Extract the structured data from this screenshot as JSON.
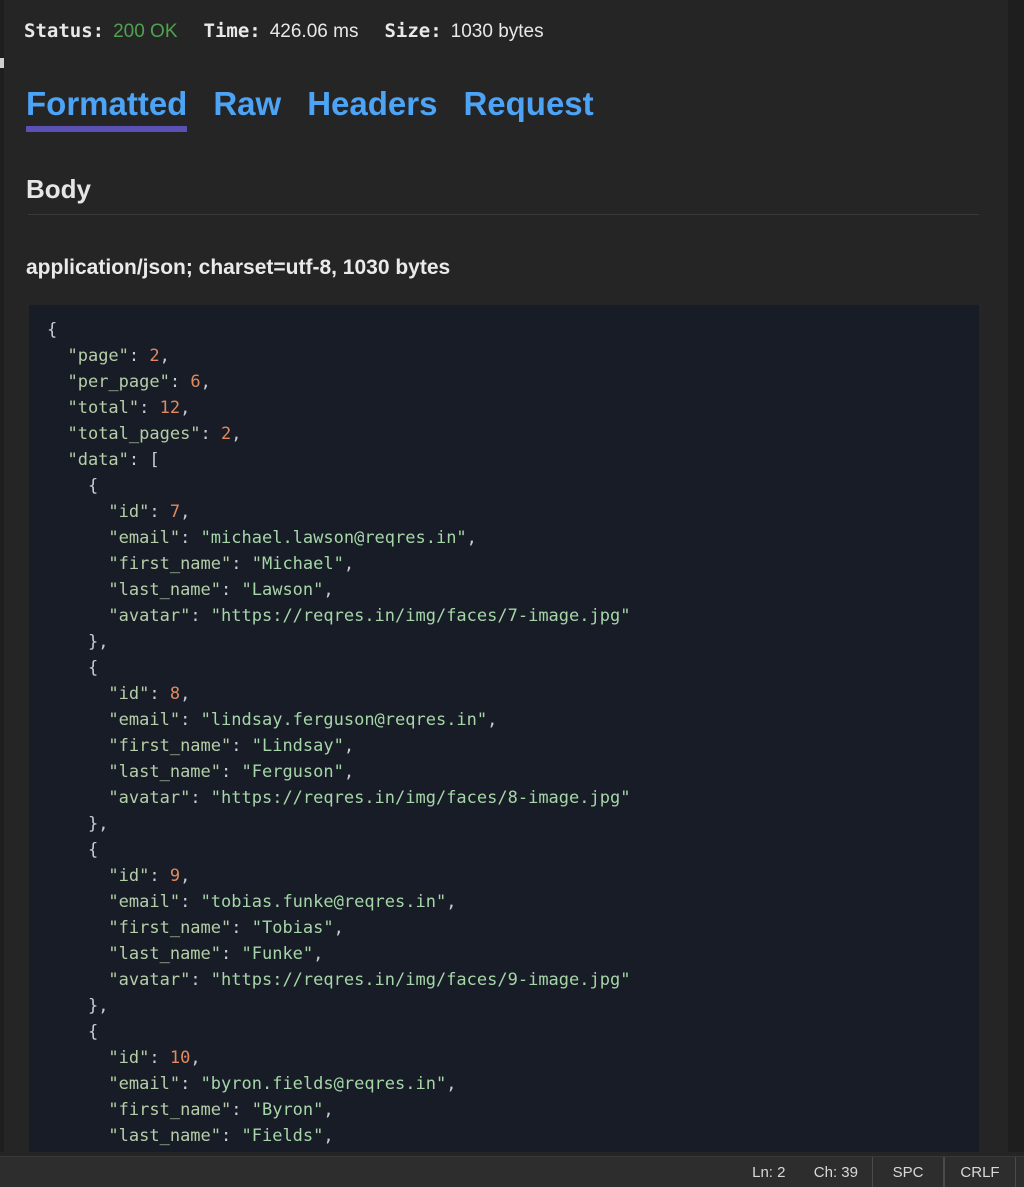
{
  "response_summary": {
    "status_label": "Status:",
    "status_value": "200 OK",
    "status_color": "#4ea24e",
    "time_label": "Time:",
    "time_value": "426.06 ms",
    "size_label": "Size:",
    "size_value": "1030 bytes"
  },
  "tabs": [
    {
      "label": "Formatted",
      "active": true
    },
    {
      "label": "Raw",
      "active": false
    },
    {
      "label": "Headers",
      "active": false
    },
    {
      "label": "Request",
      "active": false
    }
  ],
  "body_section": {
    "heading": "Body",
    "content_type": "application/json; charset=utf-8, 1030 bytes"
  },
  "code": {
    "language": "json",
    "lines": [
      "{",
      "  \"page\": 2,",
      "  \"per_page\": 6,",
      "  \"total\": 12,",
      "  \"total_pages\": 2,",
      "  \"data\": [",
      "    {",
      "      \"id\": 7,",
      "      \"email\": \"michael.lawson@reqres.in\",",
      "      \"first_name\": \"Michael\",",
      "      \"last_name\": \"Lawson\",",
      "      \"avatar\": \"https://reqres.in/img/faces/7-image.jpg\"",
      "    },",
      "    {",
      "      \"id\": 8,",
      "      \"email\": \"lindsay.ferguson@reqres.in\",",
      "      \"first_name\": \"Lindsay\",",
      "      \"last_name\": \"Ferguson\",",
      "      \"avatar\": \"https://reqres.in/img/faces/8-image.jpg\"",
      "    },",
      "    {",
      "      \"id\": 9,",
      "      \"email\": \"tobias.funke@reqres.in\",",
      "      \"first_name\": \"Tobias\",",
      "      \"last_name\": \"Funke\",",
      "      \"avatar\": \"https://reqres.in/img/faces/9-image.jpg\"",
      "    },",
      "    {",
      "      \"id\": 10,",
      "      \"email\": \"byron.fields@reqres.in\",",
      "      \"first_name\": \"Byron\",",
      "      \"last_name\": \"Fields\","
    ]
  },
  "scrollbar": {
    "up_arrow": "chevron-up-icon",
    "down_arrow": "chevron-down-icon"
  },
  "statusbar": {
    "line": "Ln: 2",
    "column": "Ch: 39",
    "indent": "SPC",
    "eol": "CRLF"
  }
}
